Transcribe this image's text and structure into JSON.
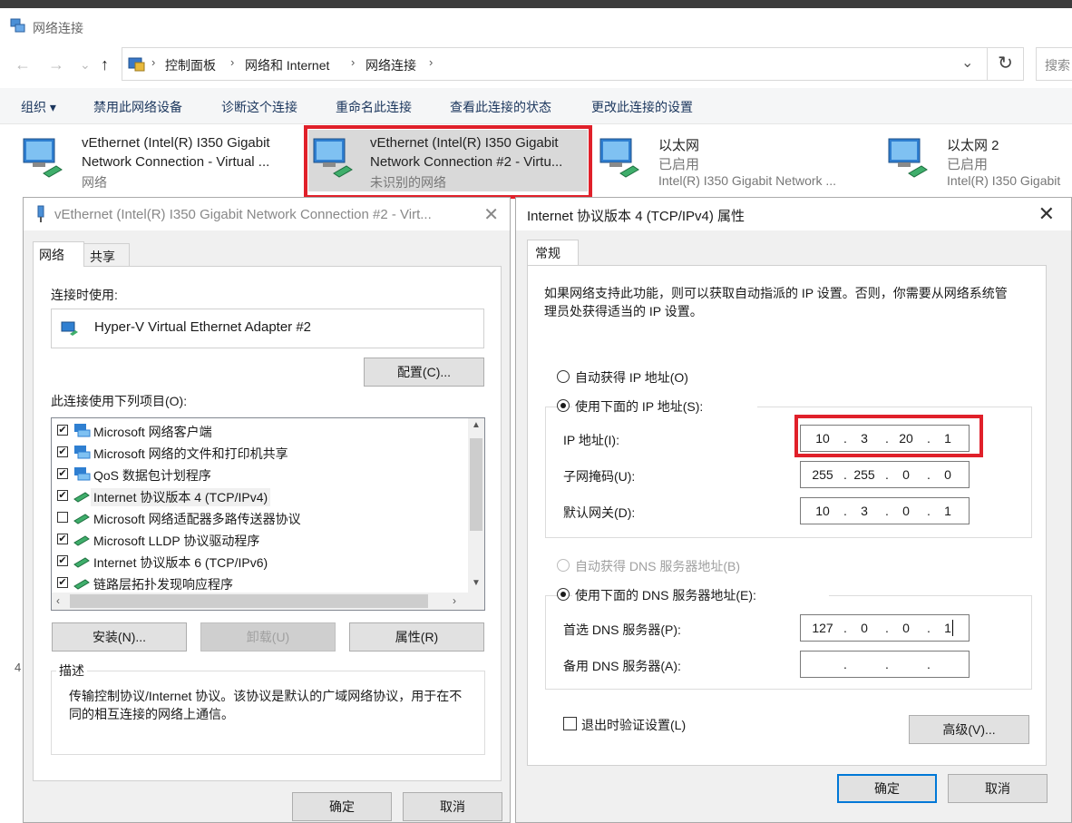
{
  "window": {
    "title": "网络连接"
  },
  "nav": {
    "back": "←",
    "forward": "→",
    "recent": "⌄",
    "up": "↑"
  },
  "breadcrumb": [
    "控制面板",
    "网络和 Internet",
    "网络连接"
  ],
  "search": {
    "placeholder": "搜索"
  },
  "commands": [
    "组织 ▾",
    "禁用此网络设备",
    "诊断这个连接",
    "重命名此连接",
    "查看此连接的状态",
    "更改此连接的设置"
  ],
  "adapters": [
    {
      "line1": "vEthernet (Intel(R) I350 Gigabit",
      "line2": "Network Connection - Virtual ...",
      "line3": "网络"
    },
    {
      "line1": "vEthernet (Intel(R) I350 Gigabit",
      "line2": "Network Connection #2 - Virtu...",
      "line3": "未识别的网络"
    },
    {
      "line1": "以太网",
      "line2": "已启用",
      "line3": "Intel(R) I350 Gigabit Network ..."
    },
    {
      "line1": "以太网 2",
      "line2": "已启用",
      "line3": "Intel(R) I350 Gigabit"
    }
  ],
  "props_dialog": {
    "title": "vEthernet (Intel(R) I350 Gigabit Network Connection #2 - Virt...",
    "close": "✕",
    "tabs": [
      "网络",
      "共享"
    ],
    "connect_using_label": "连接时使用:",
    "adapter_name": "Hyper-V Virtual Ethernet Adapter #2",
    "configure_btn": "配置(C)...",
    "items_label": "此连接使用下列项目(O):",
    "items": [
      {
        "label": "Microsoft 网络客户端",
        "checked": "✔"
      },
      {
        "label": "Microsoft 网络的文件和打印机共享",
        "checked": "✔"
      },
      {
        "label": "QoS 数据包计划程序",
        "checked": "✔"
      },
      {
        "label": "Internet 协议版本 4 (TCP/IPv4)",
        "checked": "✔"
      },
      {
        "label": "Microsoft 网络适配器多路传送器协议",
        "checked": ""
      },
      {
        "label": "Microsoft LLDP 协议驱动程序",
        "checked": "✔"
      },
      {
        "label": "Internet 协议版本 6 (TCP/IPv6)",
        "checked": "✔"
      },
      {
        "label": "链路层拓扑发现响应程序",
        "checked": "✔"
      }
    ],
    "install_btn": "安装(N)...",
    "uninstall_btn": "卸载(U)",
    "properties_btn": "属性(R)",
    "description_label": "描述",
    "description_text": "传输控制协议/Internet 协议。该协议是默认的广域网络协议，用于在不同的相互连接的网络上通信。",
    "ok_btn": "确定",
    "cancel_btn": "取消"
  },
  "ipv4_dialog": {
    "title": "Internet 协议版本 4 (TCP/IPv4) 属性",
    "close": "✕",
    "tab": "常规",
    "intro": "如果网络支持此功能，则可以获取自动指派的 IP 设置。否则，你需要从网络系统管理员处获得适当的 IP 设置。",
    "auto_ip": "自动获得 IP 地址(O)",
    "manual_ip": "使用下面的 IP 地址(S):",
    "ip_label": "IP 地址(I):",
    "ip": [
      "10",
      "3",
      "20",
      "1"
    ],
    "mask_label": "子网掩码(U):",
    "mask": [
      "255",
      "255",
      "0",
      "0"
    ],
    "gw_label": "默认网关(D):",
    "gw": [
      "10",
      "3",
      "0",
      "1"
    ],
    "auto_dns": "自动获得 DNS 服务器地址(B)",
    "manual_dns": "使用下面的 DNS 服务器地址(E):",
    "dns1_label": "首选 DNS 服务器(P):",
    "dns1": [
      "127",
      "0",
      "0",
      "1"
    ],
    "dns2_label": "备用 DNS 服务器(A):",
    "dns2": [
      "",
      "",
      "",
      ""
    ],
    "validate_label": "退出时验证设置(L)",
    "advanced_btn": "高级(V)...",
    "ok_btn": "确定",
    "cancel_btn": "取消"
  },
  "colors": {
    "highlight_border": "#e0202a",
    "accent": "#0078d7"
  }
}
